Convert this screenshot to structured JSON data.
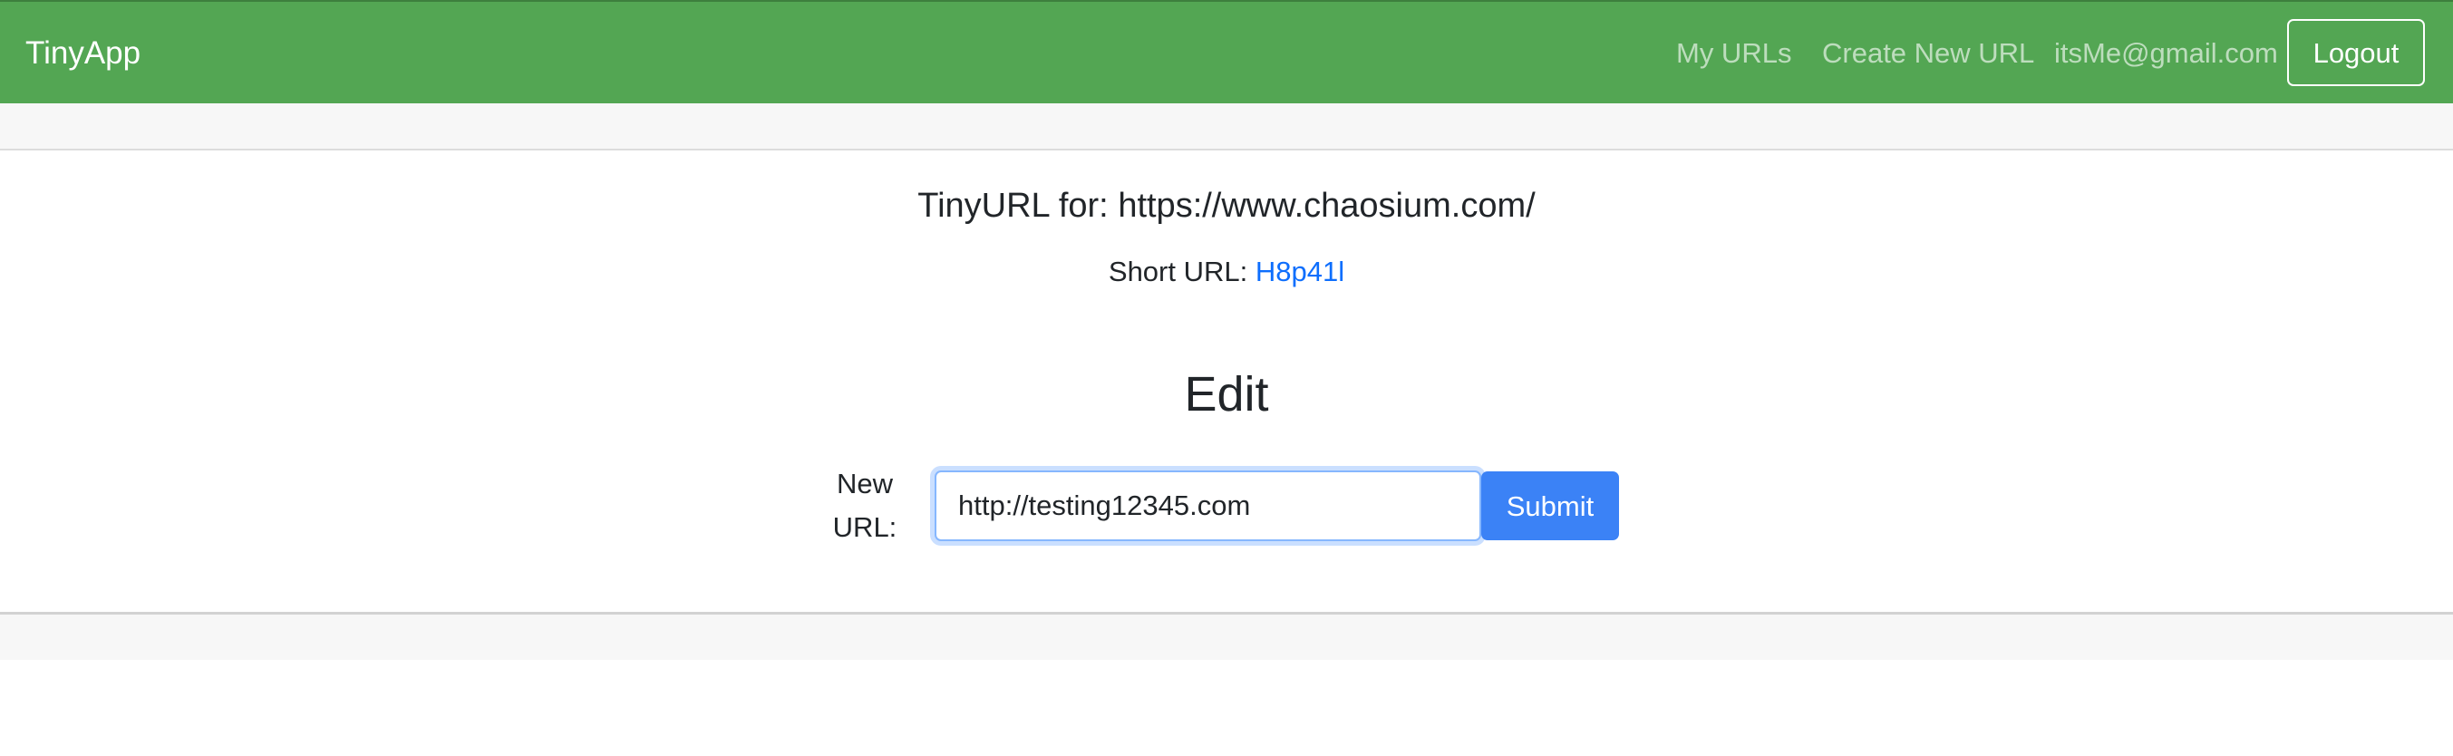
{
  "navbar": {
    "brand": "TinyApp",
    "links": [
      {
        "label": "My URLs"
      },
      {
        "label": "Create New URL"
      }
    ],
    "user_email": "itsMe@gmail.com",
    "logout_label": "Logout"
  },
  "card": {
    "title_prefix": "TinyURL for: ",
    "long_url": "https://www.chaosium.com/",
    "short_label": "Short URL: ",
    "short_id": "H8p41l",
    "edit_heading": "Edit",
    "form": {
      "label_line1": "New",
      "label_line2": "URL:",
      "input_value": "http://testing12345.com",
      "submit_label": "Submit"
    }
  },
  "colors": {
    "navbar_bg": "#53a653",
    "link_blue": "#0d6efd",
    "submit_bg": "#3b82f6",
    "page_band": "#f7f7f7"
  }
}
